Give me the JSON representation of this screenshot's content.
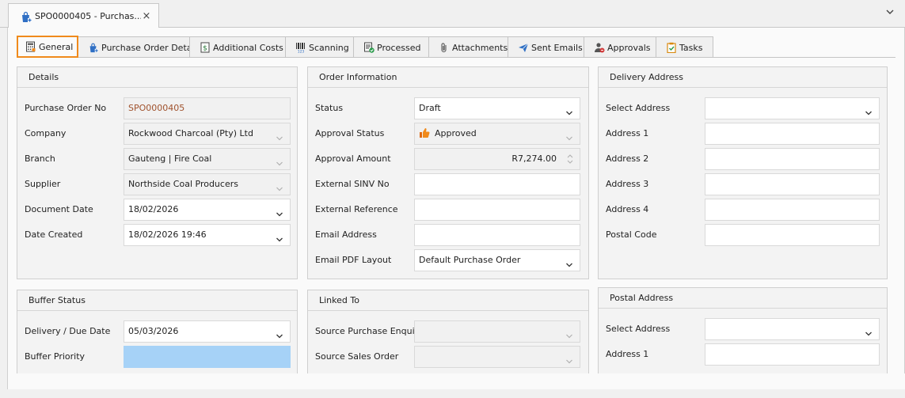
{
  "document_tab": {
    "title": "SPO0000405 - Purchas...",
    "icon": "purchase-bag-icon",
    "close_glyph": "×"
  },
  "tabs": [
    {
      "label": "General",
      "icon": "calculator-icon",
      "active": true
    },
    {
      "label": "Purchase Order Details",
      "icon": "purchase-bag-icon",
      "active": false
    },
    {
      "label": "Additional Costs",
      "icon": "dollar-doc-icon",
      "active": false
    },
    {
      "label": "Scanning",
      "icon": "barcode-icon",
      "active": false
    },
    {
      "label": "Processed",
      "icon": "doc-check-icon",
      "active": false
    },
    {
      "label": "Attachments",
      "icon": "paperclip-icon",
      "active": false
    },
    {
      "label": "Sent Emails",
      "icon": "paper-plane-icon",
      "active": false
    },
    {
      "label": "Approvals",
      "icon": "user-check-icon",
      "active": false
    },
    {
      "label": "Tasks",
      "icon": "clipboard-check-icon",
      "active": false
    }
  ],
  "details": {
    "title": "Details",
    "fields": [
      {
        "label": "Purchase Order No",
        "value": "SPO0000405"
      },
      {
        "label": "Company",
        "value": "Rockwood Charcoal (Pty) Ltd"
      },
      {
        "label": "Branch",
        "value": "Gauteng | Fire Coal"
      },
      {
        "label": "Supplier",
        "value": "Northside Coal Producers"
      },
      {
        "label": "Document Date",
        "value": "18/02/2026"
      },
      {
        "label": "Date Created",
        "value": "18/02/2026 19:46"
      }
    ]
  },
  "order_info": {
    "title": "Order Information",
    "fields": [
      {
        "label": "Status",
        "value": "Draft"
      },
      {
        "label": "Approval Status",
        "value": "Approved"
      },
      {
        "label": "Approval Amount",
        "value": "R7,274.00"
      },
      {
        "label": "External SINV No",
        "value": ""
      },
      {
        "label": "External Reference",
        "value": ""
      },
      {
        "label": "Email Address",
        "value": ""
      },
      {
        "label": "Email PDF Layout",
        "value": "Default Purchase Order"
      }
    ]
  },
  "delivery_address": {
    "title": "Delivery Address",
    "fields": [
      {
        "label": "Select Address",
        "value": ""
      },
      {
        "label": "Address 1",
        "value": ""
      },
      {
        "label": "Address 2",
        "value": ""
      },
      {
        "label": "Address 3",
        "value": ""
      },
      {
        "label": "Address 4",
        "value": ""
      },
      {
        "label": "Postal Code",
        "value": ""
      }
    ]
  },
  "buffer_status": {
    "title": "Buffer Status",
    "fields": [
      {
        "label": "Delivery / Due Date",
        "value": "05/03/2026"
      },
      {
        "label": "Buffer Priority",
        "value": "",
        "color": "#a6d2f7"
      }
    ]
  },
  "linked_to": {
    "title": "Linked To",
    "fields": [
      {
        "label": "Source Purchase Enquiry",
        "value": ""
      },
      {
        "label": "Source Sales Order",
        "value": ""
      }
    ]
  },
  "postal_address": {
    "title": "Postal Address",
    "fields": [
      {
        "label": "Select Address",
        "value": ""
      },
      {
        "label": "Address 1",
        "value": ""
      }
    ]
  },
  "colors": {
    "active_tab_border": "#f08a1c",
    "buffer_priority": "#a6d2f7",
    "ro_field_text": "#a0522d"
  }
}
